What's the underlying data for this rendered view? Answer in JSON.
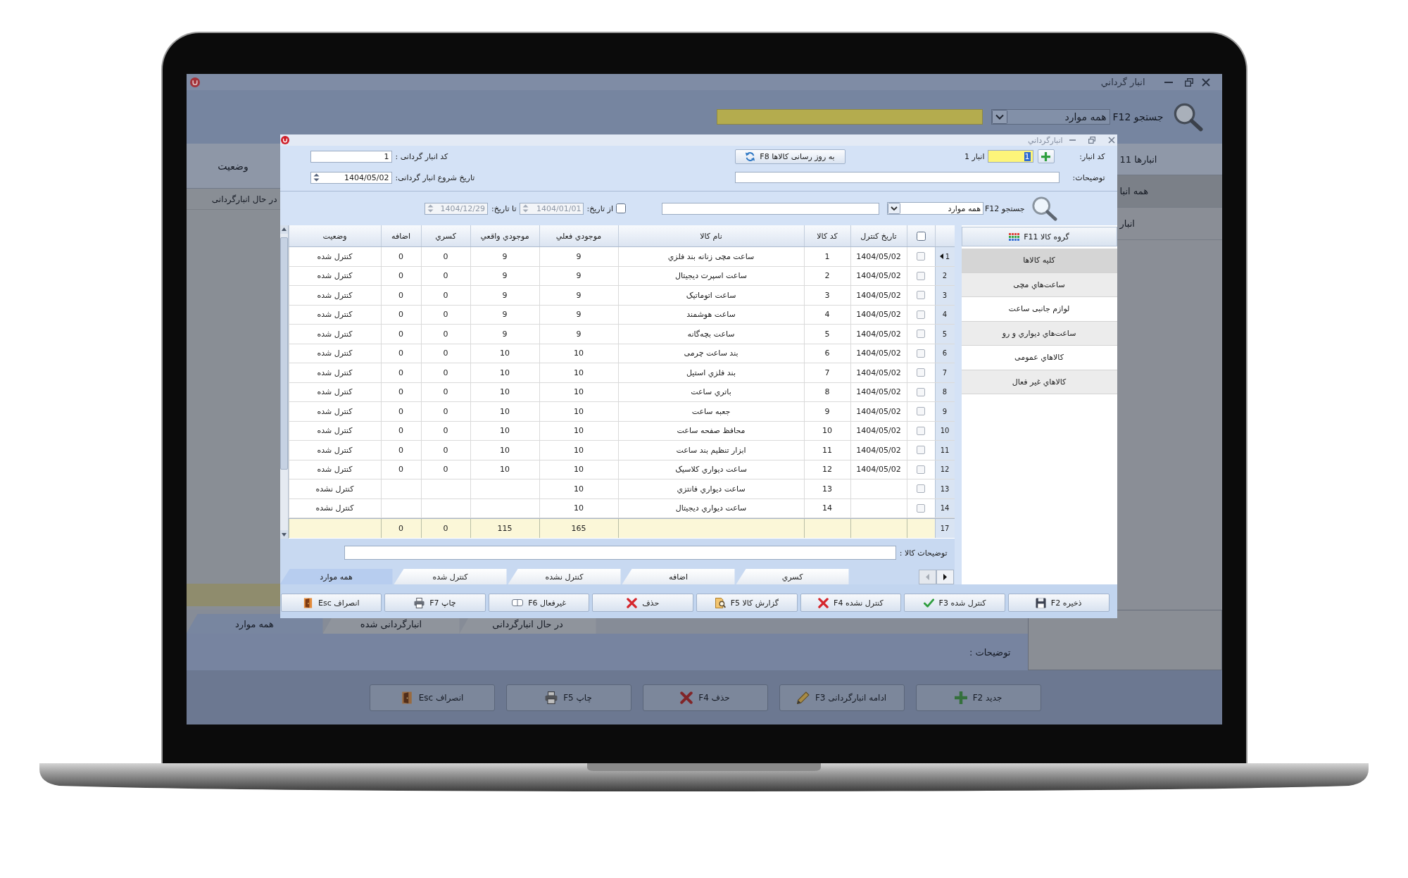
{
  "background_window": {
    "title": "انبار گرداني",
    "search": {
      "label": "جستجو F12",
      "filter": "همه موارد"
    },
    "table": {
      "column": "وضعیت",
      "rows": [
        {
          "status": "در حال انبارگردانی"
        }
      ]
    },
    "sidebar": {
      "header": "انبارها 11",
      "items": [
        {
          "label": "همه انبا",
          "selected": true
        },
        {
          "label": "انبار",
          "selected": false
        }
      ]
    },
    "tabs": [
      {
        "label": "در حال انبارگردانی",
        "selected": false
      },
      {
        "label": "انبارگردانی شده",
        "selected": false
      },
      {
        "label": "همه موارد",
        "selected": true
      }
    ],
    "description_label": "توضیحات :",
    "buttons": [
      {
        "label": "جدید F2",
        "kind": "add"
      },
      {
        "label": "ادامه انبارگردانی F3",
        "kind": "edit"
      },
      {
        "label": "حذف F4",
        "kind": "delete"
      },
      {
        "label": "چاپ F5",
        "kind": "print"
      },
      {
        "label": "انصراف Esc",
        "kind": "cancel"
      }
    ]
  },
  "dialog": {
    "title": "انبارگرداني",
    "warehouse": {
      "label": "کد انبار:",
      "value": "1",
      "text_selected": true,
      "name": "انبار 1"
    },
    "update_button": "به روز رسانی کالاها F8",
    "count_code": {
      "label": "کد انبار گردانی :",
      "value": "1"
    },
    "description": {
      "label": "توضیحات:"
    },
    "start_date": {
      "label": "تاریخ شروع انبار گردانی:",
      "value": "1404/05/02"
    },
    "search": {
      "label": "جستجو F12",
      "filter": "همه موارد",
      "date_filter_checked": false,
      "from_label": "از تاریخ:",
      "from_date": "1404/01/01",
      "to_label": "تا تاریخ:",
      "to_date": "1404/12/29"
    },
    "table": {
      "select_all_checked": false,
      "columns": [
        "تاریخ کنترل",
        "کد کالا",
        "نام کالا",
        "موجودي فعلي",
        "موجودي واقعي",
        "کسري",
        "اضافه",
        "وضعیت"
      ],
      "rows": [
        {
          "number": "1",
          "selected": true,
          "checked": false,
          "date": "1404/05/02",
          "code": "1",
          "name": "ساعت مچی زنانه بند فلزي",
          "current": "9",
          "actual": "9",
          "shortage": "0",
          "surplus": "0",
          "status": "کنترل شده"
        },
        {
          "number": "2",
          "selected": false,
          "checked": false,
          "date": "1404/05/02",
          "code": "2",
          "name": "ساعت اسپرت دیجیتال",
          "current": "9",
          "actual": "9",
          "shortage": "0",
          "surplus": "0",
          "status": "کنترل شده"
        },
        {
          "number": "3",
          "selected": false,
          "checked": false,
          "date": "1404/05/02",
          "code": "3",
          "name": "ساعت اتوماتیک",
          "current": "9",
          "actual": "9",
          "shortage": "0",
          "surplus": "0",
          "status": "کنترل شده"
        },
        {
          "number": "4",
          "selected": false,
          "checked": false,
          "date": "1404/05/02",
          "code": "4",
          "name": "ساعت هوشمند",
          "current": "9",
          "actual": "9",
          "shortage": "0",
          "surplus": "0",
          "status": "کنترل شده"
        },
        {
          "number": "5",
          "selected": false,
          "checked": false,
          "date": "1404/05/02",
          "code": "5",
          "name": "ساعت بچه‌گانه",
          "current": "9",
          "actual": "9",
          "shortage": "0",
          "surplus": "0",
          "status": "کنترل شده"
        },
        {
          "number": "6",
          "selected": false,
          "checked": false,
          "date": "1404/05/02",
          "code": "6",
          "name": "بند ساعت چرمی",
          "current": "10",
          "actual": "10",
          "shortage": "0",
          "surplus": "0",
          "status": "کنترل شده"
        },
        {
          "number": "7",
          "selected": false,
          "checked": false,
          "date": "1404/05/02",
          "code": "7",
          "name": "بند فلزي استیل",
          "current": "10",
          "actual": "10",
          "shortage": "0",
          "surplus": "0",
          "status": "کنترل شده"
        },
        {
          "number": "8",
          "selected": false,
          "checked": false,
          "date": "1404/05/02",
          "code": "8",
          "name": "باتري ساعت",
          "current": "10",
          "actual": "10",
          "shortage": "0",
          "surplus": "0",
          "status": "کنترل شده"
        },
        {
          "number": "9",
          "selected": false,
          "checked": false,
          "date": "1404/05/02",
          "code": "9",
          "name": "جعبه ساعت",
          "current": "10",
          "actual": "10",
          "shortage": "0",
          "surplus": "0",
          "status": "کنترل شده"
        },
        {
          "number": "10",
          "selected": false,
          "checked": false,
          "date": "1404/05/02",
          "code": "10",
          "name": "محافظ صفحه ساعت",
          "current": "10",
          "actual": "10",
          "shortage": "0",
          "surplus": "0",
          "status": "کنترل شده"
        },
        {
          "number": "11",
          "selected": false,
          "checked": false,
          "date": "1404/05/02",
          "code": "11",
          "name": "ابزار تنظیم بند ساعت",
          "current": "10",
          "actual": "10",
          "shortage": "0",
          "surplus": "0",
          "status": "کنترل شده"
        },
        {
          "number": "12",
          "selected": false,
          "checked": false,
          "date": "1404/05/02",
          "code": "12",
          "name": "ساعت دیواري کلاسیک",
          "current": "10",
          "actual": "10",
          "shortage": "0",
          "surplus": "0",
          "status": "کنترل شده"
        },
        {
          "number": "13",
          "selected": false,
          "checked": false,
          "code": "13",
          "name": "ساعت دیواري فانتزي",
          "current": "10",
          "status": "کنترل نشده"
        },
        {
          "number": "14",
          "selected": false,
          "checked": false,
          "code": "14",
          "name": "ساعت دیواري دیجیتال",
          "current": "10",
          "status": "کنترل نشده"
        }
      ],
      "total": {
        "number": "17",
        "current": "165",
        "actual": "115",
        "shortage": "0",
        "surplus": "0"
      }
    },
    "categories": {
      "header": "گروه کالا F11",
      "items": [
        {
          "label": "کلیه کالاها",
          "selected": true
        },
        {
          "label": "ساعت‌هاي مچی",
          "selected": false
        },
        {
          "label": "لوازم جانبی ساعت",
          "selected": false
        },
        {
          "label": "ساعت‌هاي دیواري و رو",
          "selected": false
        },
        {
          "label": "کالاهاي عمومی",
          "selected": false
        },
        {
          "label": "کالاهاي غیر فعال",
          "selected": false
        }
      ]
    },
    "item_description": {
      "label": "توضیحات کالا :"
    },
    "tabs": [
      {
        "label": "کسري",
        "selected": false
      },
      {
        "label": "اضافه",
        "selected": false
      },
      {
        "label": "کنترل نشده",
        "selected": false
      },
      {
        "label": "کنترل شده",
        "selected": false
      },
      {
        "label": "همه موارد",
        "selected": true
      }
    ],
    "buttons": [
      {
        "label": "ذخیره F2",
        "kind": "save"
      },
      {
        "label": "کنترل شده F3",
        "kind": "confirm"
      },
      {
        "label": "کنترل نشده F4",
        "kind": "reject"
      },
      {
        "label": "گزارش کالا F5",
        "kind": "report"
      },
      {
        "label": "حذف",
        "kind": "delete"
      },
      {
        "label": "غیرفعال F6",
        "kind": "deactivate"
      },
      {
        "label": "چاپ F7",
        "kind": "print"
      },
      {
        "label": "انصراف Esc",
        "kind": "cancel"
      }
    ]
  }
}
